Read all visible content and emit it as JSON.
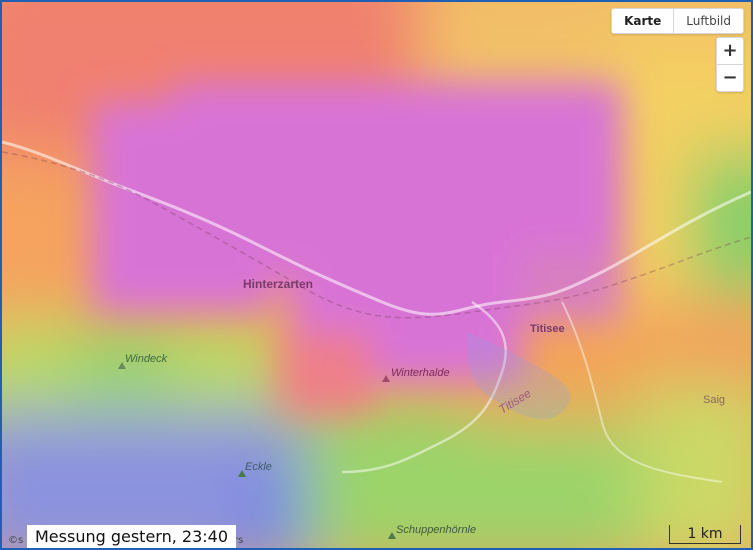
{
  "map": {
    "type_toggle": [
      {
        "label": "Karte",
        "active": true
      },
      {
        "label": "Luftbild",
        "active": false
      }
    ],
    "zoom_in_label": "+",
    "zoom_out_label": "−",
    "attribution": "©s",
    "attribution_tail": "chers",
    "measurement_label": "Messung gestern, 23:40",
    "scale_label": "1 km",
    "places": {
      "hinterzarten": "Hinterzarten",
      "titisee_town": "Titisee",
      "saig": "Saig"
    },
    "peaks": {
      "windeck": "Windeck",
      "winterhalde": "Winterhalde",
      "eckle": "Eckle",
      "schuppenhoernle": "Schuppenhörnle"
    },
    "lake_label": "Titisee",
    "colors": {
      "frame_border": "#1f5fb4",
      "purple": "#d873d6",
      "red": "#f08070",
      "orange": "#f5a35f",
      "yellow": "#f3d25f",
      "green": "#8ed36d",
      "blue": "#7f8ee6"
    }
  }
}
